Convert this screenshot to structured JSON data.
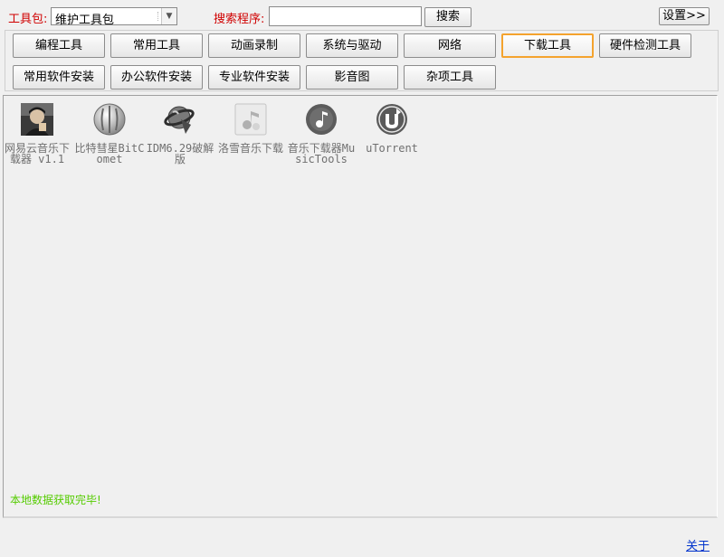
{
  "toolbar": {
    "toolkit_label": "工具包:",
    "toolkit_selected": "维护工具包",
    "search_label": "搜索程序:",
    "search_value": "",
    "search_button": "搜索",
    "settings_button": "设置>>"
  },
  "categories": [
    {
      "label": "编程工具",
      "active": false
    },
    {
      "label": "常用工具",
      "active": false
    },
    {
      "label": "动画录制",
      "active": false
    },
    {
      "label": "系统与驱动",
      "active": false
    },
    {
      "label": "网络",
      "active": false
    },
    {
      "label": "下载工具",
      "active": true
    },
    {
      "label": "硬件检测工具",
      "active": false
    },
    {
      "label": "常用软件安装",
      "active": false
    },
    {
      "label": "办公软件安装",
      "active": false
    },
    {
      "label": "专业软件安装",
      "active": false
    },
    {
      "label": "影音图",
      "active": false
    },
    {
      "label": "杂项工具",
      "active": false
    }
  ],
  "apps": [
    {
      "name": "网易云音乐下载器 v1.1",
      "icon": "photo-avatar-icon"
    },
    {
      "name": "比特彗星BitComet",
      "icon": "bitcomet-icon"
    },
    {
      "name": "IDM6.29破解版",
      "icon": "idm-globe-icon"
    },
    {
      "name": "洛雪音乐下载",
      "icon": "music-note-icon"
    },
    {
      "name": "音乐下载器MusicTools",
      "icon": "music-disc-icon"
    },
    {
      "name": "uTorrent",
      "icon": "utorrent-icon"
    }
  ],
  "status_text": "本地数据获取完毕!",
  "close_link": "关于",
  "colors": {
    "label_red": "#d00000",
    "active_border": "#f4a32e",
    "status_green": "#55cc00",
    "link_blue": "#0033cc"
  }
}
